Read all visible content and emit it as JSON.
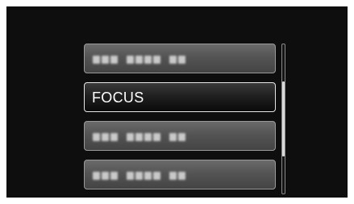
{
  "menu": {
    "items": [
      {
        "label": "",
        "state": "blurred",
        "groups": [
          3,
          4,
          2
        ]
      },
      {
        "label": "FOCUS",
        "state": "selected"
      },
      {
        "label": "",
        "state": "blurred",
        "groups": [
          3,
          4,
          2
        ]
      },
      {
        "label": "",
        "state": "blurred",
        "groups": [
          3,
          4,
          2
        ]
      }
    ]
  },
  "scrollbar": {
    "position": 0.25,
    "visible_fraction": 0.5
  },
  "colors": {
    "screen_bg": "#0e0e0e",
    "selected_border": "#e6e6e6",
    "item_border": "#9a9a9a",
    "text": "#ffffff"
  }
}
